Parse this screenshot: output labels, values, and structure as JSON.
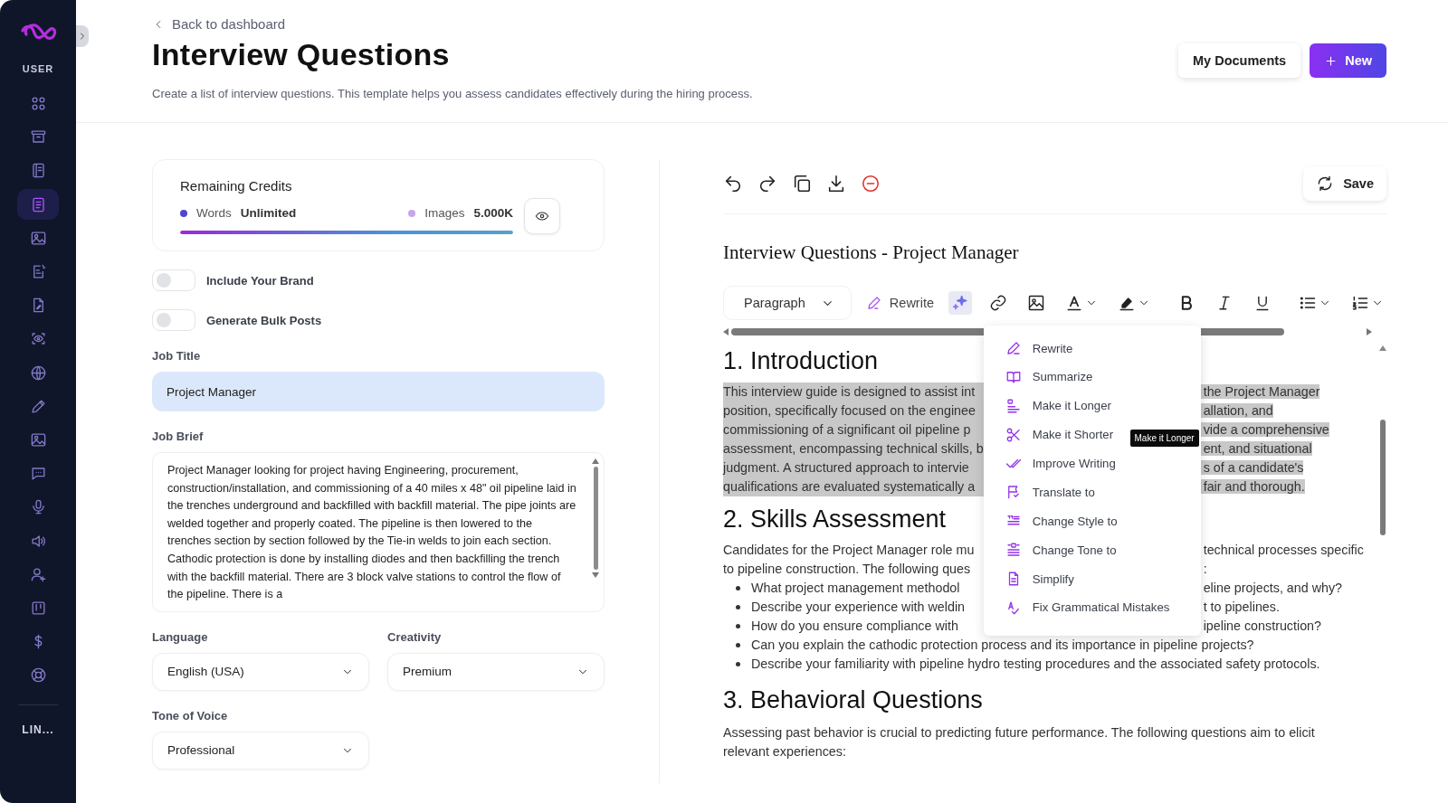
{
  "sidebar": {
    "section": "USER",
    "items": [
      {
        "selected": false
      },
      {
        "selected": false
      },
      {
        "selected": false
      },
      {
        "selected": true
      },
      {
        "selected": false
      },
      {
        "selected": false
      },
      {
        "selected": false
      },
      {
        "selected": false
      },
      {
        "selected": false
      },
      {
        "selected": false
      },
      {
        "selected": false
      },
      {
        "selected": false
      },
      {
        "selected": false
      },
      {
        "selected": false
      },
      {
        "selected": false
      },
      {
        "selected": false
      },
      {
        "selected": false
      },
      {
        "selected": false
      }
    ],
    "footer": "LIN..."
  },
  "header": {
    "back_link": "Back to dashboard",
    "title": "Interview Questions",
    "description": "Create a list of interview questions. This template helps you assess candidates effectively during the hiring process.",
    "buttons": [
      {
        "kind": "secondary",
        "label": "My Documents"
      },
      {
        "kind": "primary",
        "label": "New"
      }
    ]
  },
  "credits": {
    "title": "Remaining Credits",
    "level": 1,
    "items": [
      {
        "label": "Words",
        "value": "Unlimited",
        "color": "#4f46c8"
      },
      {
        "label": "Images",
        "value": "5.000K",
        "color": "#c8a6e8"
      }
    ]
  },
  "toggles": [
    {
      "label": "Include Your Brand",
      "on": false
    },
    {
      "label": "Generate Bulk Posts",
      "on": false
    }
  ],
  "job_title": {
    "label": "Job Title",
    "value": "Project Manager"
  },
  "job_brief": {
    "label": "Job Brief",
    "value": "Project Manager looking for project having Engineering, procurement, construction/installation, and commissioning of a 40 miles x 48\" oil pipeline laid in the trenches underground and backfilled with backfill material. The pipe joints are welded together and properly coated. The pipeline is then lowered to the trenches section by section followed by the Tie-in welds to join each section. Cathodic protection is done by installing diodes and then backfilling the trench with the backfill material. There are 3 block valve stations to control the flow of the pipeline. There is a"
  },
  "selects": [
    {
      "label": "Language",
      "value": "English (USA)"
    },
    {
      "label": "Creativity",
      "value": "Premium"
    },
    {
      "label": "Tone of Voice",
      "value": "Professional"
    }
  ],
  "editor": {
    "save": "Save",
    "doc_title": "Interview Questions - Project Manager",
    "block_format": "Paragraph",
    "rewrite": "Rewrite",
    "tools": [
      {
        "kind": "ai",
        "selected": true
      },
      {
        "kind": "link",
        "selected": false
      },
      {
        "kind": "image",
        "selected": false
      },
      {
        "kind": "text-color",
        "selected": false
      },
      {
        "kind": "highlight",
        "selected": false
      },
      {
        "kind": "bold",
        "selected": false
      },
      {
        "kind": "italic",
        "selected": false
      },
      {
        "kind": "underline",
        "selected": false
      },
      {
        "kind": "bullet-list",
        "selected": false
      },
      {
        "kind": "numbered-list",
        "selected": false
      }
    ],
    "ai_menu": {
      "tooltip": "Make it Longer",
      "items": [
        {
          "label": "Rewrite"
        },
        {
          "label": "Summarize"
        },
        {
          "label": "Make it Longer"
        },
        {
          "label": "Make it Shorter"
        },
        {
          "label": "Improve Writing"
        },
        {
          "label": "Translate to"
        },
        {
          "label": "Change Style to"
        },
        {
          "label": "Change Tone to"
        },
        {
          "label": "Simplify"
        },
        {
          "label": "Fix Grammatical Mistakes"
        }
      ]
    },
    "blocks": [
      {
        "kind": "heading",
        "text": "1. Introduction"
      },
      {
        "kind": "line",
        "left": "This interview guide is designed to assist int",
        "right": "the Project Manager",
        "highlighted": true
      },
      {
        "kind": "line",
        "left": "position, specifically focused on the enginee",
        "right": "allation, and",
        "highlighted": true
      },
      {
        "kind": "line",
        "left": "commissioning of a significant oil pipeline p",
        "right": "vide a comprehensive",
        "highlighted": true
      },
      {
        "kind": "line",
        "left": "assessment, encompassing technical skills, b",
        "right": "ent, and situational",
        "highlighted": true
      },
      {
        "kind": "line",
        "left": "judgment. A structured approach to intervie",
        "right": "s of a candidate's",
        "highlighted": true
      },
      {
        "kind": "line",
        "left": "qualifications are evaluated systematically a",
        "right": "fair and thorough.",
        "highlighted": true
      },
      {
        "kind": "heading",
        "text": "2. Skills Assessment"
      },
      {
        "kind": "line",
        "left": "Candidates for the Project Manager role mu",
        "right": "technical processes specific",
        "highlighted": false
      },
      {
        "kind": "line",
        "left": "to pipeline construction. The following ques",
        "right": ":",
        "highlighted": false
      },
      {
        "kind": "bullet",
        "left": "What project management methodol",
        "right": "eline projects, and why?"
      },
      {
        "kind": "bullet",
        "left": "Describe your experience with weldin",
        "right": "t to pipelines."
      },
      {
        "kind": "bullet",
        "left": "How do you ensure compliance with",
        "right": "ipeline construction?"
      },
      {
        "kind": "bullet",
        "text": "Can you explain the cathodic protection process and its importance in pipeline projects?"
      },
      {
        "kind": "bullet",
        "text": "Describe your familiarity with pipeline hydro testing procedures and the associated safety protocols."
      },
      {
        "kind": "heading",
        "text": "3. Behavioral Questions"
      },
      {
        "kind": "line",
        "text": "Assessing past behavior is crucial to predicting future performance. The following questions aim to elicit relevant experiences:",
        "highlighted": false
      }
    ]
  }
}
